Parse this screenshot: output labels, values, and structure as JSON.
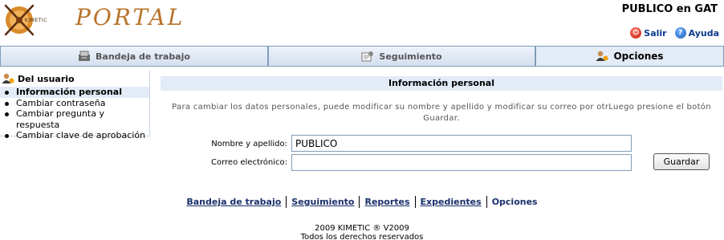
{
  "header": {
    "logo_text": "KIMETIC",
    "portal_text": "PORTAL",
    "user_label": "PUBLICO en GAT",
    "links": [
      {
        "label": "Salir",
        "icon": "power-icon"
      },
      {
        "label": "Ayuda",
        "icon": "help-icon"
      }
    ]
  },
  "tabs": [
    {
      "label": "Bandeja de trabajo",
      "icon": "inbox-tray-icon",
      "active": false
    },
    {
      "label": "Seguimiento",
      "icon": "tracking-icon",
      "active": false
    },
    {
      "label": "Opciones",
      "icon": "user-options-icon",
      "active": true
    }
  ],
  "sidebar": {
    "title": "Del usuario",
    "items": [
      {
        "label": "Información personal",
        "active": true
      },
      {
        "label": "Cambiar contraseña",
        "active": false
      },
      {
        "label": "Cambiar pregunta y respuesta",
        "active": false
      },
      {
        "label": "Cambiar clave de aprobación",
        "active": false
      }
    ]
  },
  "main": {
    "title": "Información personal",
    "intro": "Para cambiar los datos personales, puede modificar su nombre y apellido y modificar su correo por otrLuego presione el botón Guardar.",
    "name_label": "Nombre y apellido:",
    "name_value": "PUBLICO",
    "email_label": "Correo electrónico:",
    "email_value": "",
    "save_label": "Guardar"
  },
  "footer": {
    "links": [
      "Bandeja de trabajo",
      "Seguimiento",
      "Reportes",
      "Expedientes"
    ],
    "current": "Opciones",
    "copyright_line1": "2009 KIMETIC ®  V2009",
    "copyright_line2": "Todos los derechos reservados"
  },
  "colors": {
    "tab_bg": "#e3ebf7",
    "tab_border": "#7f9db9",
    "link_blue": "#1a2f6b",
    "portal_orange": "#b8732a"
  }
}
